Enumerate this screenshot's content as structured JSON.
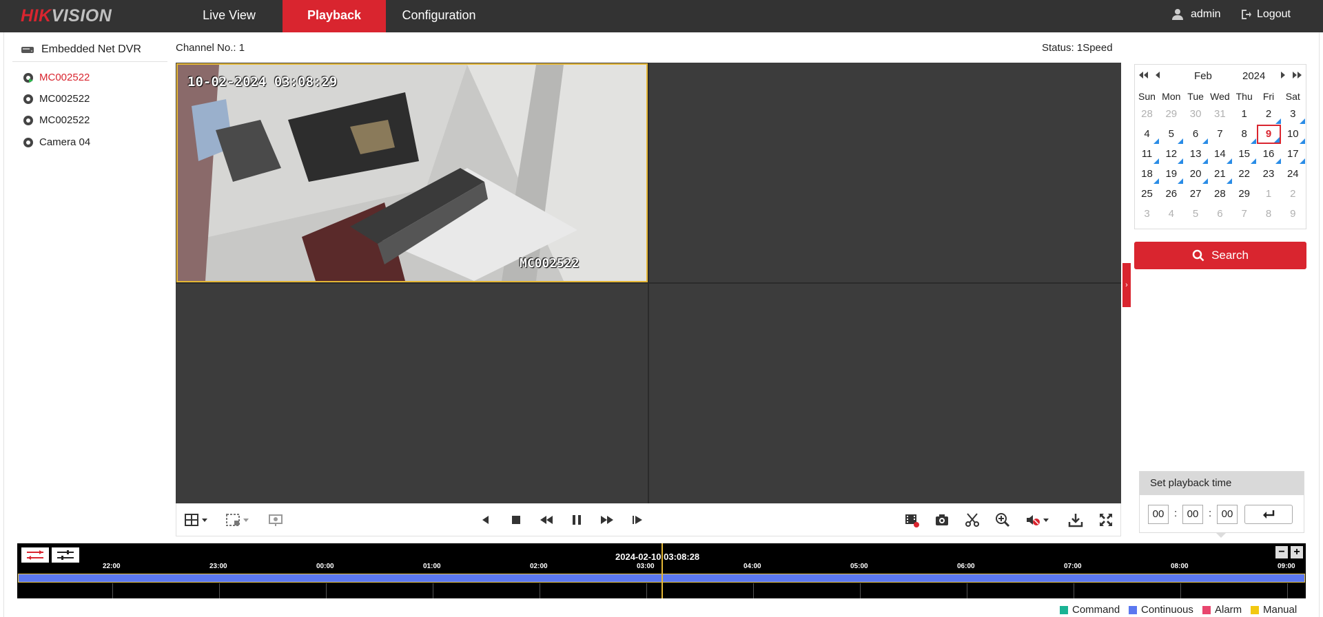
{
  "header": {
    "logo_primary": "HIK",
    "logo_secondary": "VISION",
    "tabs": [
      {
        "label": "Live View"
      },
      {
        "label": "Playback"
      },
      {
        "label": "Configuration"
      }
    ],
    "active_tab": "Playback",
    "user": "admin",
    "logout": "Logout",
    "brand_color": "#d9252f"
  },
  "sidebar": {
    "device": "Embedded Net DVR",
    "cameras": [
      {
        "label": "MC002522",
        "active": true
      },
      {
        "label": "MC002522",
        "active": false
      },
      {
        "label": "MC002522",
        "active": false
      },
      {
        "label": "Camera 04",
        "active": false
      }
    ]
  },
  "main": {
    "channel": "Channel No.: 1",
    "status": "Status: 1Speed",
    "video": {
      "timestamp": "10-02-2024 03:08:29",
      "camera_label": "MC002522"
    }
  },
  "calendar": {
    "month": "Feb",
    "year": "2024",
    "weekdays": [
      "Sun",
      "Mon",
      "Tue",
      "Wed",
      "Thu",
      "Fri",
      "Sat"
    ],
    "days": [
      {
        "d": "28",
        "muted": true,
        "rec": false
      },
      {
        "d": "29",
        "muted": true,
        "rec": false
      },
      {
        "d": "30",
        "muted": true,
        "rec": false
      },
      {
        "d": "31",
        "muted": true,
        "rec": false
      },
      {
        "d": "1",
        "muted": false,
        "rec": false
      },
      {
        "d": "2",
        "muted": false,
        "rec": true
      },
      {
        "d": "3",
        "muted": false,
        "rec": true
      },
      {
        "d": "4",
        "muted": false,
        "rec": true
      },
      {
        "d": "5",
        "muted": false,
        "rec": true
      },
      {
        "d": "6",
        "muted": false,
        "rec": true
      },
      {
        "d": "7",
        "muted": false,
        "rec": false
      },
      {
        "d": "8",
        "muted": false,
        "rec": true
      },
      {
        "d": "9",
        "muted": false,
        "rec": true,
        "selected": true
      },
      {
        "d": "10",
        "muted": false,
        "rec": true
      },
      {
        "d": "11",
        "muted": false,
        "rec": true
      },
      {
        "d": "12",
        "muted": false,
        "rec": true
      },
      {
        "d": "13",
        "muted": false,
        "rec": true
      },
      {
        "d": "14",
        "muted": false,
        "rec": true
      },
      {
        "d": "15",
        "muted": false,
        "rec": true
      },
      {
        "d": "16",
        "muted": false,
        "rec": true
      },
      {
        "d": "17",
        "muted": false,
        "rec": true
      },
      {
        "d": "18",
        "muted": false,
        "rec": true
      },
      {
        "d": "19",
        "muted": false,
        "rec": true
      },
      {
        "d": "20",
        "muted": false,
        "rec": true
      },
      {
        "d": "21",
        "muted": false,
        "rec": true
      },
      {
        "d": "22",
        "muted": false,
        "rec": false
      },
      {
        "d": "23",
        "muted": false,
        "rec": false
      },
      {
        "d": "24",
        "muted": false,
        "rec": false
      },
      {
        "d": "25",
        "muted": false,
        "rec": false
      },
      {
        "d": "26",
        "muted": false,
        "rec": false
      },
      {
        "d": "27",
        "muted": false,
        "rec": false
      },
      {
        "d": "28",
        "muted": false,
        "rec": false
      },
      {
        "d": "29",
        "muted": false,
        "rec": false
      },
      {
        "d": "1",
        "muted": true,
        "rec": false
      },
      {
        "d": "2",
        "muted": true,
        "rec": false
      },
      {
        "d": "3",
        "muted": true,
        "rec": false
      },
      {
        "d": "4",
        "muted": true,
        "rec": false
      },
      {
        "d": "5",
        "muted": true,
        "rec": false
      },
      {
        "d": "6",
        "muted": true,
        "rec": false
      },
      {
        "d": "7",
        "muted": true,
        "rec": false
      },
      {
        "d": "8",
        "muted": true,
        "rec": false
      },
      {
        "d": "9",
        "muted": true,
        "rec": false
      }
    ],
    "search_label": "Search"
  },
  "playback_time": {
    "title": "Set playback time",
    "hh": "00",
    "mm": "00",
    "ss": "00"
  },
  "timeline": {
    "current": "2024-02-10 03:08:28",
    "ticks": [
      "22:00",
      "23:00",
      "00:00",
      "01:00",
      "02:00",
      "03:00",
      "04:00",
      "05:00",
      "06:00",
      "07:00",
      "08:00",
      "09:00"
    ]
  },
  "legend": [
    {
      "label": "Command",
      "color": "#1ab394"
    },
    {
      "label": "Continuous",
      "color": "#5b78f0"
    },
    {
      "label": "Alarm",
      "color": "#e8466e"
    },
    {
      "label": "Manual",
      "color": "#f2c811"
    }
  ]
}
